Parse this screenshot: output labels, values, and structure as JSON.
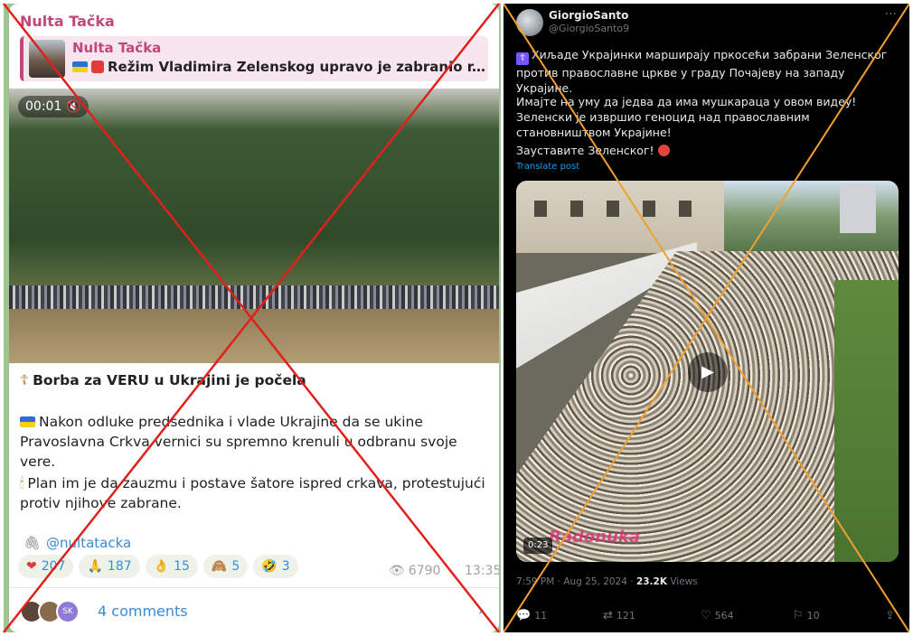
{
  "telegram": {
    "channel_name": "Nulta Tačka",
    "reply": {
      "author": "Nulta Tačka",
      "text": "Režim Vladimira Zelenskog upravo je zabranio r..."
    },
    "video": {
      "time": "00:01"
    },
    "heading": "Borba za VERU u Ukrajini je počela",
    "paragraph1": "Nakon odluke predsednika i vlade Ukrajine da se ukine Pravoslavna Crkva vernici su spremno krenuli u odbranu svoje vere.",
    "paragraph2": "Plan im je da zauzmu i postave šatore ispred crkava, protestujući protiv njihove zabrane.",
    "handle": "@nultatacka",
    "reactions": [
      {
        "emoji": "❤",
        "count": "207",
        "color": "#e0393e"
      },
      {
        "emoji": "🙏",
        "count": "187",
        "color": "#f0b33b"
      },
      {
        "emoji": "👌",
        "count": "15",
        "color": "#f0b33b"
      },
      {
        "emoji": "🙈",
        "count": "5",
        "color": "#b07a3a"
      },
      {
        "emoji": "🤣",
        "count": "3",
        "color": "#f0b33b"
      }
    ],
    "views": "6790",
    "time": "13:35",
    "avatar_initials": "SK",
    "comments": "4 comments",
    "bg_color": "#9ec48f",
    "accent": "#c2487c",
    "link_color": "#3a8bd8"
  },
  "x_post": {
    "name": "GiorgioSanto",
    "handle": "@GiorgioSanto9",
    "line1": "Хиљаде Украјинки марширају пркосећи забрани Зеленског против православне цркве у граду Почајеву на западу Украјине.",
    "line2": "Имајте на уму да једва да има мушкараца у овом видеу! Зеленски је извршио геноцид над православним становништвом Украјине!",
    "line3": "Зауставите Зеленског!",
    "translate": "Translate post",
    "video_duration": "0:23",
    "watermark": "Radonuka",
    "timestamp": "7:59 PM · Aug 25, 2024 · ",
    "views_count": "23.2K",
    "views_label": " Views",
    "stats": {
      "replies": "11",
      "reposts": "121",
      "likes": "564",
      "bookmarks": "10"
    },
    "bg_color": "#000000",
    "link_color": "#1d9bf0"
  },
  "overlay": {
    "left_cross_color": "#e0201c",
    "right_cross_color": "#f0a030"
  }
}
